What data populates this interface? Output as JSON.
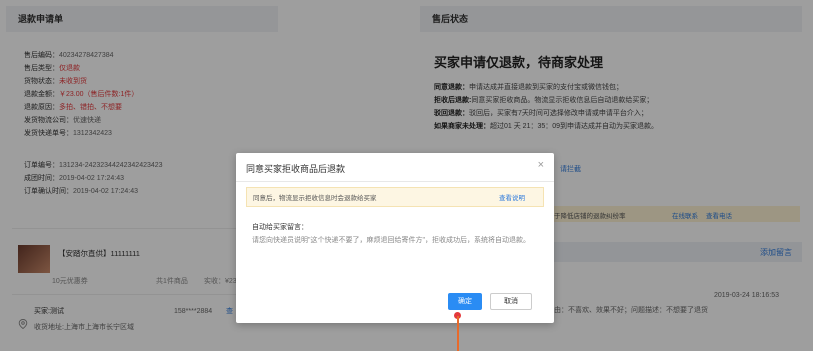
{
  "left": {
    "title": "退款申请单",
    "rows": [
      {
        "k": "售后编码：",
        "v": "40234278427384",
        "red": false
      },
      {
        "k": "售后类型：",
        "v": "仅退款",
        "red": true
      },
      {
        "k": "货物状态：",
        "v": "未收到货",
        "red": true
      },
      {
        "k": "退款金额：",
        "v": "￥23.00（售后件数:1件）",
        "red": true
      },
      {
        "k": "退款原因：",
        "v": "多拍、错拍、不想要",
        "red": true
      },
      {
        "k": "发货物流公司：",
        "v": "优速快递",
        "red": false
      },
      {
        "k": "发货快递单号：",
        "v": "1312342423",
        "red": false
      }
    ],
    "order_rows": [
      {
        "k": "订单编号：",
        "v": "131234-24232344242342423423"
      },
      {
        "k": "成团时间：",
        "v": "2019-04-02 17:24:43"
      },
      {
        "k": "订单确认时间：",
        "v": "2019-04-02 17:24:43"
      }
    ],
    "product": {
      "name": "【安踏尔直供】11111111",
      "coupon": "10元优惠券",
      "count": "共1件商品",
      "paid": "实收：¥23"
    },
    "buyer": {
      "name": "买家:测试",
      "phone": "158****2884",
      "more": "查",
      "address": "收货地址:上海市上海市长宁区域"
    }
  },
  "right": {
    "title": "售后状态",
    "headline": "买家申请仅退款，待商家处理",
    "lines": [
      {
        "b": "同意退款：",
        "t": "申请达成并直接退款到买家的支付宝或微信钱包；"
      },
      {
        "b": "拒收后退款:",
        "t": "同意买家拒收商品。物流显示拒收信息后自动退款给买家；"
      },
      {
        "b": "驳回退款：",
        "t": "驳回后，买家有7天时间可选择修改申请或申请平台介入；"
      },
      {
        "b": "如果商家未处理：",
        "t": "超过01 天 21：35：09到申请达成并自动为买家退款。"
      }
    ],
    "intercept_link": "请拦截",
    "platform_text": "于降低店铺的退款纠纷率",
    "contact_link": "在线联系",
    "phone_link": "查看电话",
    "add_note": "添加留言",
    "note_time": "2019-03-24 18:16:53",
    "note_text": "由：不喜欢、效果不好；问题描述：不想要了退货"
  },
  "modal": {
    "title": "同意买家拒收商品后退款",
    "close": "×",
    "notice": "同意后，物流显示拒收信息时会退款给买家",
    "notice_link": "查看说明",
    "msg_label": "自动给买家留言：",
    "msg_body": "请您向快递员说明\"这个快递不要了，麻烦退回给寄件方\"，拒收成功后，系统将自动退款。",
    "ok": "确定",
    "cancel": "取消"
  }
}
